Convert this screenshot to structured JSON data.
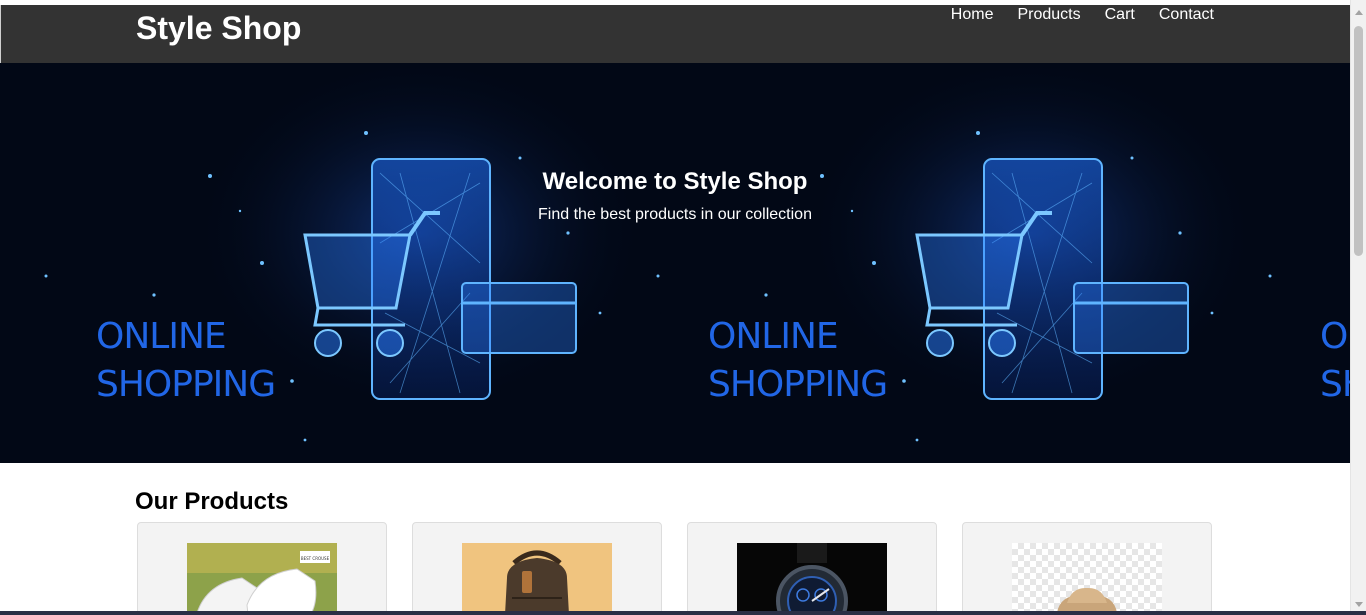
{
  "site": {
    "logo": "Style Shop"
  },
  "nav": {
    "items": [
      "Home",
      "Products",
      "Cart",
      "Contact"
    ]
  },
  "hero": {
    "title": "Welcome to Style Shop",
    "subtitle": "Find the best products in our collection",
    "banner_text_line1": "ONLINE",
    "banner_text_line2": "SHOPPING",
    "background_color": "#020816",
    "accent_color": "#1f6ee8"
  },
  "products": {
    "heading": "Our Products",
    "items": [
      {
        "image": "sneakers-image",
        "image_tag": "BEST CROUSE"
      },
      {
        "image": "backpack-image"
      },
      {
        "image": "watch-image"
      },
      {
        "image": "hat-image"
      }
    ]
  },
  "colors": {
    "header_bg": "#333333",
    "card_bg": "#f3f3f3"
  }
}
